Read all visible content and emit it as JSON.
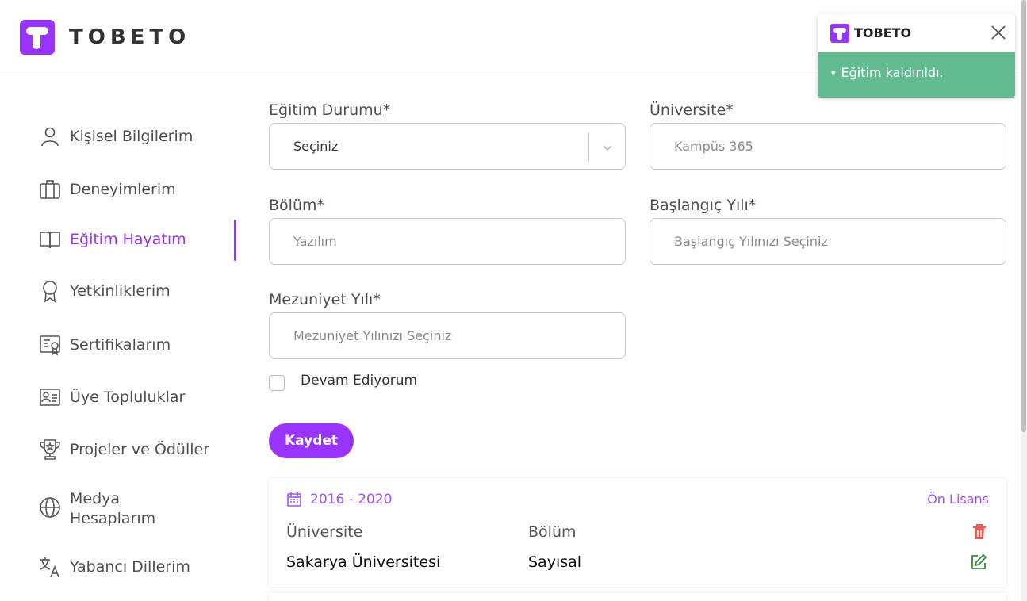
{
  "brand": {
    "name": "TOBETO",
    "color": "#9933ff"
  },
  "sidebar": {
    "items": [
      {
        "label": "Kişisel Bilgilerim",
        "icon": "person-icon",
        "active": false
      },
      {
        "label": "Deneyimlerim",
        "icon": "briefcase-icon",
        "active": false
      },
      {
        "label": "Eğitim Hayatım",
        "icon": "book-icon",
        "active": true
      },
      {
        "label": "Yetkinliklerim",
        "icon": "award-icon",
        "active": false
      },
      {
        "label": "Sertifikalarım",
        "icon": "certificate-icon",
        "active": false
      },
      {
        "label": "Üye Topluluklar",
        "icon": "id-card-icon",
        "active": false
      },
      {
        "label": "Projeler ve Ödüller",
        "icon": "trophy-icon",
        "active": false
      },
      {
        "label_line1": "Medya",
        "label_line2": "Hesaplarım",
        "icon": "globe-icon",
        "active": false
      },
      {
        "label": "Yabancı Dillerim",
        "icon": "translate-icon",
        "active": false
      }
    ]
  },
  "form": {
    "education_status": {
      "label": "Eğitim Durumu*",
      "value": "Seçiniz"
    },
    "university": {
      "label": "Üniversite*",
      "placeholder": "Kampüs 365"
    },
    "department": {
      "label": "Bölüm*",
      "placeholder": "Yazılım"
    },
    "start_year": {
      "label": "Başlangıç Yılı*",
      "placeholder": "Başlangıç Yılınızı Seçiniz"
    },
    "graduation_year": {
      "label": "Mezuniyet Yılı*",
      "placeholder": "Mezuniyet Yılınızı Seçiniz"
    },
    "ongoing": {
      "label": "Devam Ediyorum",
      "checked": false
    },
    "save_label": "Kaydet"
  },
  "education_card": {
    "years": "2016 - 2020",
    "level": "Ön Lisans",
    "university_header": "Üniversite",
    "department_header": "Bölüm",
    "university_value": "Sakarya Üniversitesi",
    "department_value": "Sayısal"
  },
  "toast": {
    "title": "TOBETO",
    "message": "• Eğitim kaldırıldı.",
    "color": "#63bb92"
  }
}
